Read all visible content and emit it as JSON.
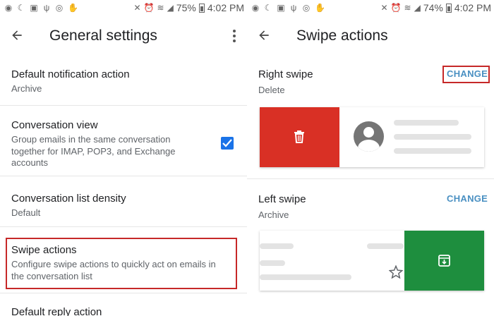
{
  "statusbar_left": {
    "battery": "75%",
    "time": "4:02 PM"
  },
  "statusbar_right": {
    "battery": "74%",
    "time": "4:02 PM"
  },
  "general": {
    "title": "General settings",
    "items": [
      {
        "title": "Default notification action",
        "subtitle": "Archive"
      },
      {
        "title": "Conversation view",
        "subtitle_lines": [
          "Group emails in the same conversation",
          "together for IMAP, POP3, and Exchange",
          "accounts"
        ],
        "checked": true
      },
      {
        "title": "Conversation list density",
        "subtitle": "Default"
      },
      {
        "title": "Swipe actions",
        "subtitle_lines": [
          "Configure swipe actions to quickly act on emails in",
          "the conversation list"
        ]
      },
      {
        "title": "Default reply action"
      }
    ]
  },
  "swipe": {
    "title": "Swipe actions",
    "right": {
      "title": "Right swipe",
      "action": "Delete",
      "change_label": "CHANGE",
      "color": "#d93025"
    },
    "left": {
      "title": "Left swipe",
      "action": "Archive",
      "change_label": "CHANGE",
      "color": "#1e8e3e"
    }
  },
  "colors": {
    "accent": "#1a73e8",
    "change_text": "#4a90c2",
    "highlight": "#c62828"
  },
  "icons": [
    "spotify-icon",
    "moon-icon",
    "image-icon",
    "usb-icon",
    "instagram-icon",
    "hand-icon",
    "mute-icon",
    "alarm-icon",
    "wifi-icon",
    "signal-icon",
    "battery-icon",
    "back-arrow-icon",
    "more-vert-icon",
    "trash-icon",
    "avatar-icon",
    "star-icon",
    "archive-icon"
  ]
}
